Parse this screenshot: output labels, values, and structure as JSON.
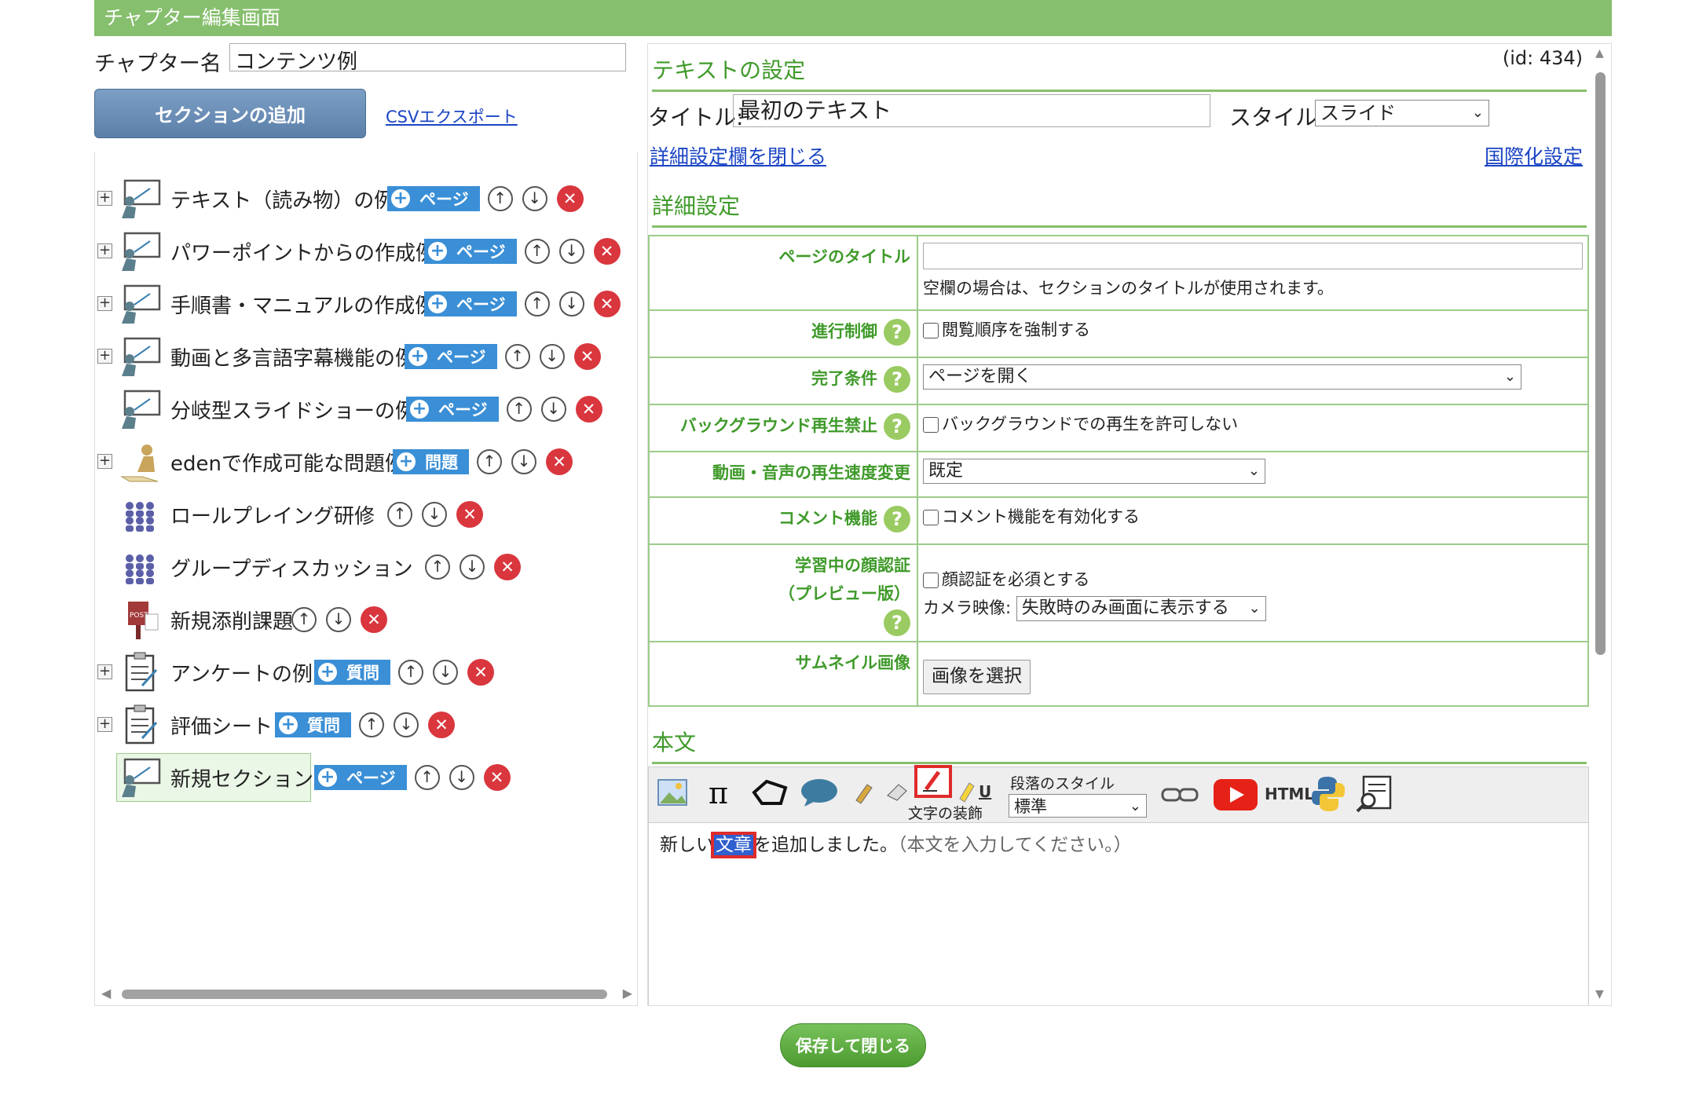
{
  "window": {
    "title": "チャプター編集画面"
  },
  "chapter": {
    "name_label": "チャプター名 :",
    "name_value": "コンテンツ例"
  },
  "left": {
    "add_section_label": "セクションの追加",
    "csv_export_label": "CSVエクスポート",
    "tree": [
      {
        "label": "テキスト（読み物）の例",
        "add_label": "ページ"
      },
      {
        "label": "パワーポイントからの作成例",
        "add_label": "ページ"
      },
      {
        "label": "手順書・マニュアルの作成例",
        "add_label": "ページ"
      },
      {
        "label": "動画と多言語字幕機能の例",
        "add_label": "ページ"
      },
      {
        "label": "分岐型スライドショーの例",
        "add_label": "ページ"
      },
      {
        "label": "edenで作成可能な問題例",
        "add_label": "問題"
      },
      {
        "label": "ロールプレイング研修",
        "add_label": ""
      },
      {
        "label": "グループディスカッション",
        "add_label": ""
      },
      {
        "label": "新規添削課題",
        "add_label": ""
      },
      {
        "label": "アンケートの例",
        "add_label": "質問"
      },
      {
        "label": "評価シート",
        "add_label": "質問"
      },
      {
        "label": "新規セクション",
        "add_label": "ページ"
      }
    ]
  },
  "right": {
    "id_label": "(id: 434)",
    "text_settings_heading": "テキストの設定",
    "title_label": "タイトル:",
    "title_value": "最初のテキスト",
    "style_label": "スタイル:",
    "style_value": "スライド",
    "close_details_link": "詳細設定欄を閉じる",
    "i18n_link": "国際化設定",
    "details_heading": "詳細設定",
    "rows": {
      "page_title_label": "ページのタイトル",
      "page_title_note": "空欄の場合は、セクションのタイトルが使用されます。",
      "progress_label": "進行制御",
      "progress_check": "閲覧順序を強制する",
      "complete_label": "完了条件",
      "complete_value": "ページを開く",
      "bg_label": "バックグラウンド再生禁止",
      "bg_check": "バックグラウンドでの再生を許可しない",
      "speed_label": "動画・音声の再生速度変更",
      "speed_value": "既定",
      "comment_label": "コメント機能",
      "comment_check": "コメント機能を有効化する",
      "face_label_1": "学習中の顔認証",
      "face_label_2": "（プレビュー版）",
      "face_check": "顔認証を必須とする",
      "camera_label": "カメラ映像:",
      "camera_value": "失敗時のみ画面に表示する",
      "thumb_label": "サムネイル画像",
      "thumb_button": "画像を選択"
    },
    "body_heading": "本文",
    "toolbar": {
      "paragraph_style_label": "段落のスタイル",
      "paragraph_style_value": "標準",
      "decoration_label": "文字の装飾",
      "html_label": "HTML"
    },
    "editor": {
      "text_before": "新しい",
      "text_selected": "文章",
      "text_after": "を追加しました。",
      "hint": "（本文を入力してください。）"
    }
  },
  "save_close_label": "保存して閉じる",
  "colors": {
    "accent": "#86bf6d",
    "link": "#1a44c4",
    "section_green": "#3f9a2a",
    "delete": "#d9363e"
  }
}
